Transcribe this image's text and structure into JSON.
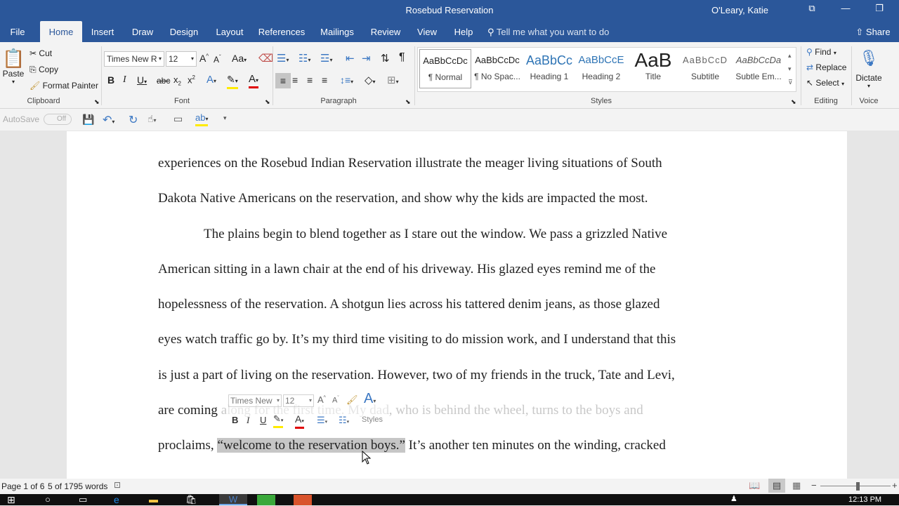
{
  "window": {
    "title": "Rosebud Reservation",
    "user": "O'Leary, Katie"
  },
  "tabs": [
    "File",
    "Home",
    "Insert",
    "Draw",
    "Design",
    "Layout",
    "References",
    "Mailings",
    "Review",
    "View",
    "Help"
  ],
  "tell_me": "Tell me what you want to do",
  "share": "Share",
  "clipboard": {
    "paste": "Paste",
    "cut": "Cut",
    "copy": "Copy",
    "format_painter": "Format Painter",
    "label": "Clipboard"
  },
  "font": {
    "name": "Times New R",
    "size": "12",
    "label": "Font"
  },
  "paragraph": {
    "label": "Paragraph"
  },
  "styles": {
    "label": "Styles",
    "items": [
      {
        "preview": "AaBbCcDc",
        "name": "¶ Normal"
      },
      {
        "preview": "AaBbCcDc",
        "name": "¶ No Spac..."
      },
      {
        "preview": "AaBbCc",
        "name": "Heading 1"
      },
      {
        "preview": "AaBbCcE",
        "name": "Heading 2"
      },
      {
        "preview": "AaB",
        "name": "Title"
      },
      {
        "preview": "AaBbCcD",
        "name": "Subtitle"
      },
      {
        "preview": "AaBbCcDa",
        "name": "Subtle Em..."
      }
    ]
  },
  "editing": {
    "find": "Find",
    "replace": "Replace",
    "select": "Select",
    "label": "Editing"
  },
  "voice": {
    "dictate": "Dictate",
    "label": "Voice"
  },
  "qat": {
    "autosave": "AutoSave",
    "toggle": "Off"
  },
  "document": {
    "line1": "experiences on the Rosebud Indian Reservation illustrate the meager living situations of South",
    "line2": "Dakota Native Americans on the reservation, and show why the kids are impacted the most.",
    "line3": "The plains begin to blend together as I stare out the window. We pass a grizzled Native",
    "line4": "American sitting in a lawn chair at the end of his driveway. His glazed eyes remind me of the",
    "line5": "hopelessness of the reservation. A shotgun lies across his tattered denim jeans, as those glazed",
    "line6": "eyes watch traffic go by. It’s my third time visiting to do mission work, and I understand that this",
    "line7": "is just a part of living on the reservation. However, two of my friends in the truck, Tate and Levi,",
    "line8a": "are coming",
    "line8b": "along for the first time. My dad, who is behind the wheel, turns to the boys and",
    "line9a": "proclaims, ",
    "line9b": "“welcome to the reservation boys.”",
    "line9c": " It’s another ten minutes on the winding, cracked"
  },
  "mini_toolbar": {
    "font": "Times New",
    "size": "12",
    "styles": "Styles"
  },
  "status": {
    "page": "Page 1 of 6",
    "words": "5 of 1795 words"
  },
  "taskbar": {
    "time": "12:13 PM"
  }
}
